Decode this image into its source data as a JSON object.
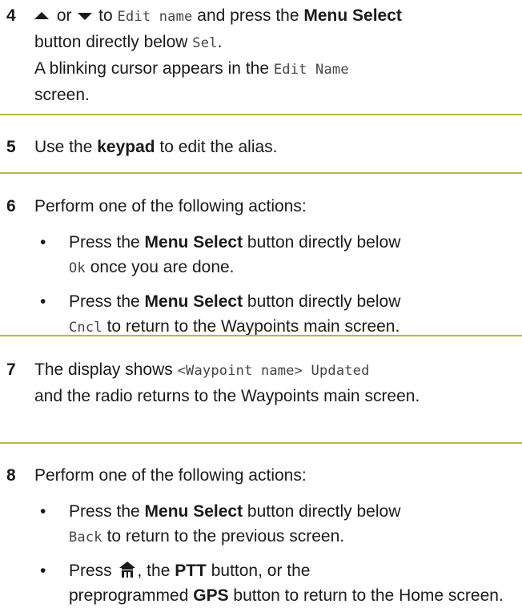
{
  "steps": [
    {
      "number": "4",
      "parts": {
        "or": " or ",
        "to": " to ",
        "edit_name_code": "Edit name",
        "and_press": " and press the ",
        "menu_select": "Menu Select",
        "button_below": " button directly below ",
        "sel_code": "Sel",
        "period": ".",
        "cursor_text": "A blinking cursor appears in the ",
        "edit_name_screen_code": "Edit Name",
        "screen_text": "screen."
      }
    },
    {
      "number": "5",
      "parts": {
        "use_the": "Use the ",
        "keypad": "keypad",
        "rest": " to edit the alias."
      }
    },
    {
      "number": "6",
      "intro": "Perform one of the following actions:",
      "bullets": [
        {
          "press_the": "Press the ",
          "menu_select": "Menu Select",
          "button_below": " button directly below",
          "code": "Ok",
          "rest": " once you are done."
        },
        {
          "press_the": "Press the ",
          "menu_select": "Menu Select",
          "button_below": " button directly below",
          "code": "Cncl",
          "rest": " to return to the Waypoints main screen."
        }
      ]
    },
    {
      "number": "7",
      "parts": {
        "display_shows": "The display shows ",
        "code": "<Waypoint name> Updated",
        "rest": "and the radio returns to the Waypoints main screen."
      }
    },
    {
      "number": "8",
      "intro": "Perform one of the following actions:",
      "bullets": [
        {
          "press_the": "Press the ",
          "menu_select": "Menu Select",
          "button_below": " button directly below",
          "code": "Back",
          "rest": " to return to the previous screen."
        },
        {
          "press": "Press ",
          "comma_the": ", the ",
          "ptt": "PTT",
          "button_or": " button, or the",
          "preprogrammed": "preprogrammed ",
          "gps": "GPS",
          "rest": " button to return to the Home screen."
        }
      ]
    }
  ],
  "colors": {
    "rule": "#b8b84a",
    "text": "#1a1a1a",
    "code_text": "#444444"
  },
  "icons": [
    "arrow-up-icon",
    "arrow-down-icon",
    "home-icon"
  ]
}
